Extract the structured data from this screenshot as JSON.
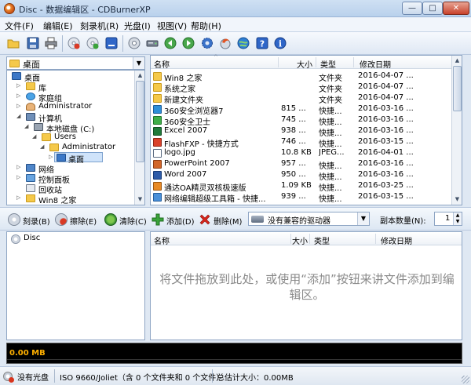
{
  "window": {
    "title": "Disc - 数据编辑区 - CDBurnerXP",
    "min": "—",
    "max": "□",
    "close": "✕"
  },
  "menu": [
    "文件(F)",
    "编辑(E)",
    "刻录机(R)",
    "光盘(I)",
    "视图(V)",
    "帮助(H)"
  ],
  "toolbar_icons": [
    "open-icon",
    "save-icon",
    "print-icon",
    "erase-disc-icon",
    "verify-disc-icon",
    "eject-icon",
    "disc-info-icon",
    "drive-icon",
    "back-icon",
    "forward-icon",
    "settings-icon",
    "burn-icon",
    "web-update-icon",
    "help-icon",
    "info-icon"
  ],
  "location": {
    "value": "桌面"
  },
  "tree": {
    "items": [
      {
        "label": "桌面",
        "icon": "desktop-icon"
      },
      {
        "label": "库",
        "icon": "library-icon"
      },
      {
        "label": "家庭组",
        "icon": "homegroup-icon"
      },
      {
        "label": "Administrator",
        "icon": "user-icon"
      },
      {
        "label": "计算机",
        "icon": "computer-icon"
      },
      {
        "label": "本地磁盘 (C:)",
        "icon": "disk-icon"
      },
      {
        "label": "Users",
        "icon": "folder-icon"
      },
      {
        "label": "Administrator",
        "icon": "folder-icon"
      },
      {
        "label": "桌面",
        "icon": "folder-icon"
      },
      {
        "label": "网络",
        "icon": "network-icon"
      },
      {
        "label": "控制面板",
        "icon": "control-panel-icon"
      },
      {
        "label": "回收站",
        "icon": "recycle-bin-icon"
      },
      {
        "label": "Win8 之家",
        "icon": "folder-icon"
      }
    ]
  },
  "file_list": {
    "headers": {
      "name": "名称",
      "size": "大小",
      "type": "类型",
      "date": "修改日期"
    },
    "rows": [
      {
        "name": "Win8 之家",
        "size": "",
        "type": "文件夹",
        "date": "2016-04-07 ...",
        "icon": "folder-icon"
      },
      {
        "name": "系统之家",
        "size": "",
        "type": "文件夹",
        "date": "2016-04-07 ...",
        "icon": "folder-icon"
      },
      {
        "name": "新建文件夹",
        "size": "",
        "type": "文件夹",
        "date": "2016-04-07 ...",
        "icon": "folder-icon"
      },
      {
        "name": "360安全浏览器7",
        "size": "815 ...",
        "type": "快捷...",
        "date": "2016-03-16 ...",
        "icon": "shortcut-icon"
      },
      {
        "name": "360安全卫士",
        "size": "745 ...",
        "type": "快捷...",
        "date": "2016-03-16 ...",
        "icon": "shortcut-icon"
      },
      {
        "name": "Excel 2007",
        "size": "938 ...",
        "type": "快捷...",
        "date": "2016-03-16 ...",
        "icon": "shortcut-icon"
      },
      {
        "name": "FlashFXP - 快捷方式",
        "size": "746 ...",
        "type": "快捷...",
        "date": "2016-03-15 ...",
        "icon": "shortcut-icon"
      },
      {
        "name": "logo.jpg",
        "size": "10.8 KB",
        "type": "JPEG...",
        "date": "2016-04-01 ...",
        "icon": "image-icon"
      },
      {
        "name": "PowerPoint 2007",
        "size": "957 ...",
        "type": "快捷...",
        "date": "2016-03-16 ...",
        "icon": "shortcut-icon"
      },
      {
        "name": "Word 2007",
        "size": "950 ...",
        "type": "快捷...",
        "date": "2016-03-16 ...",
        "icon": "shortcut-icon"
      },
      {
        "name": "通达OA精灵双核极速版",
        "size": "1.09 KB",
        "type": "快捷...",
        "date": "2016-03-25 ...",
        "icon": "shortcut-icon"
      },
      {
        "name": "网络编辑超级工具箱 - 快捷...",
        "size": "939 ...",
        "type": "快捷...",
        "date": "2016-03-15 ...",
        "icon": "shortcut-icon"
      }
    ]
  },
  "actions": {
    "burn": "刻录(B)",
    "erase": "擦除(E)",
    "clear": "清除(C)",
    "add": "添加(D)",
    "delete": "删除(M)",
    "drive": "没有兼容的驱动器",
    "copies_label": "副本数量(N):",
    "copies_value": "1"
  },
  "disc_tree": {
    "root": "Disc"
  },
  "disc_list": {
    "headers": {
      "name": "名称",
      "size": "大小",
      "type": "类型",
      "date": "修改日期"
    },
    "hint": "将文件拖放到此处，或使用“添加”按钮来讲文件添加到编辑区。"
  },
  "capacity": {
    "used": "0.00 MB"
  },
  "status": {
    "disc": "没有光盘",
    "fs": "ISO 9660/Joliet（含 0 个文件夹和 0 个文件）",
    "total": "总估计大小：0.00MB"
  },
  "colors": {
    "window_bg": "#dfe8f3",
    "selection": "#cfe3fa",
    "capacity_text": "#ffb000",
    "hint_text": "#8a8a8a"
  }
}
